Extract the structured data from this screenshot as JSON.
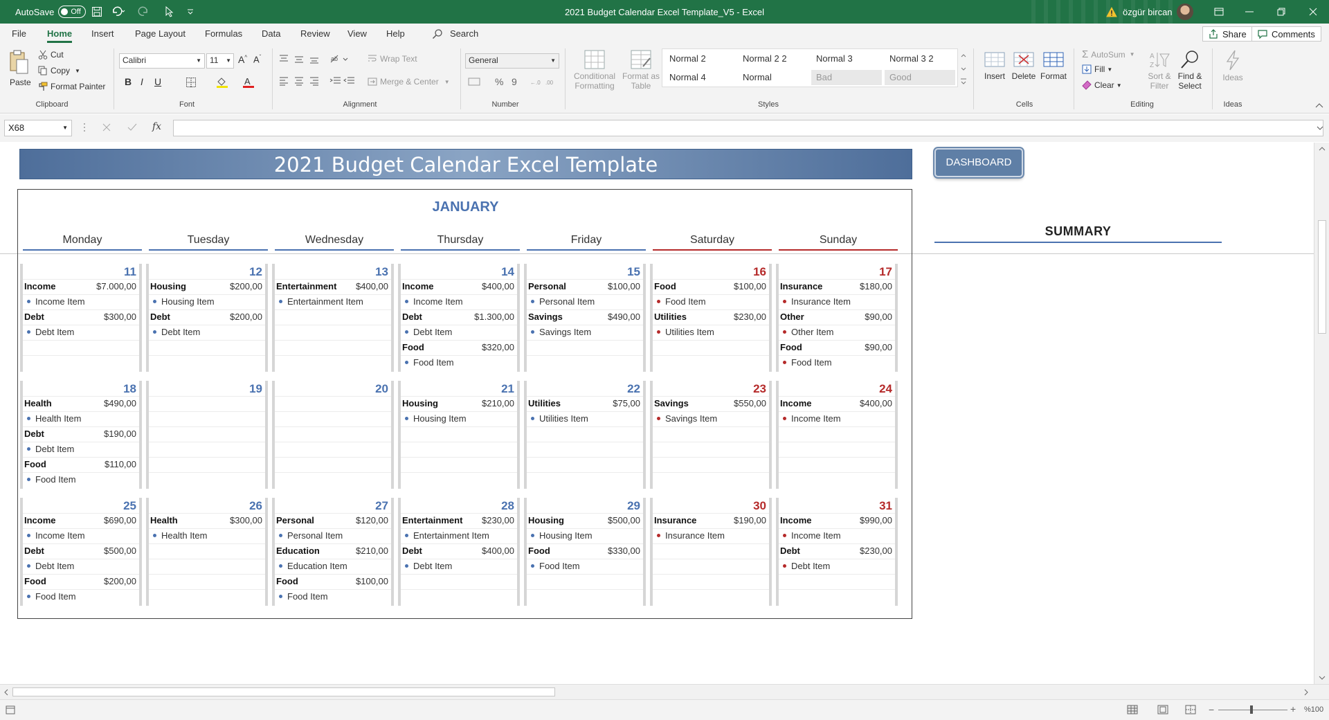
{
  "titlebar": {
    "autosave_label": "AutoSave",
    "autosave_state": "Off",
    "title": "2021 Budget Calendar Excel Template_V5  -  Excel",
    "user": "özgür bircan"
  },
  "menu": {
    "tabs": [
      "File",
      "Home",
      "Insert",
      "Page Layout",
      "Formulas",
      "Data",
      "Review",
      "View",
      "Help"
    ],
    "active": "Home",
    "search": "Search",
    "share": "Share",
    "comments": "Comments"
  },
  "ribbon": {
    "clipboard": {
      "paste": "Paste",
      "cut": "Cut",
      "copy": "Copy",
      "format_painter": "Format Painter",
      "label": "Clipboard"
    },
    "font": {
      "name": "Calibri",
      "size": "11",
      "label": "Font"
    },
    "alignment": {
      "wrap": "Wrap Text",
      "merge": "Merge & Center",
      "label": "Alignment"
    },
    "number": {
      "format": "General",
      "label": "Number"
    },
    "styles": {
      "conditional_1": "Conditional",
      "conditional_2": "Formatting",
      "format_table_1": "Format as",
      "format_table_2": "Table",
      "cells": [
        "Normal 2",
        "Normal 2 2",
        "Normal 3",
        "Normal 3 2",
        "Normal 4",
        "Normal",
        "Bad",
        "Good"
      ],
      "label": "Styles"
    },
    "cells": {
      "insert": "Insert",
      "delete": "Delete",
      "format": "Format",
      "label": "Cells"
    },
    "editing": {
      "autosum": "AutoSum",
      "fill": "Fill",
      "clear": "Clear",
      "sort_1": "Sort &",
      "sort_2": "Filter",
      "find_1": "Find &",
      "find_2": "Select",
      "label": "Editing"
    },
    "ideas": {
      "ideas": "Ideas",
      "label": "Ideas"
    }
  },
  "formula": {
    "namebox": "X68",
    "value": ""
  },
  "sheet": {
    "banner": "2021 Budget Calendar Excel Template",
    "dashboard": "DASHBOARD",
    "month": "JANUARY",
    "summary": "SUMMARY",
    "days": [
      "Monday",
      "Tuesday",
      "Wednesday",
      "Thursday",
      "Friday",
      "Saturday",
      "Sunday"
    ],
    "weeks": [
      [
        {
          "day": "11",
          "entries": [
            {
              "cat": "Income",
              "amt": "$7.000,00",
              "item": "Income Item"
            },
            {
              "cat": "Debt",
              "amt": "$300,00",
              "item": "Debt Item"
            }
          ]
        },
        {
          "day": "12",
          "entries": [
            {
              "cat": "Housing",
              "amt": "$200,00",
              "item": "Housing Item"
            },
            {
              "cat": "Debt",
              "amt": "$200,00",
              "item": "Debt Item"
            }
          ]
        },
        {
          "day": "13",
          "entries": [
            {
              "cat": "Entertainment",
              "amt": "$400,00",
              "item": "Entertainment Item"
            }
          ]
        },
        {
          "day": "14",
          "entries": [
            {
              "cat": "Income",
              "amt": "$400,00",
              "item": "Income Item"
            },
            {
              "cat": "Debt",
              "amt": "$1.300,00",
              "item": "Debt Item"
            },
            {
              "cat": "Food",
              "amt": "$320,00",
              "item": "Food Item"
            }
          ]
        },
        {
          "day": "15",
          "entries": [
            {
              "cat": "Personal",
              "amt": "$100,00",
              "item": "Personal Item"
            },
            {
              "cat": "Savings",
              "amt": "$490,00",
              "item": "Savings Item"
            }
          ]
        },
        {
          "day": "16",
          "entries": [
            {
              "cat": "Food",
              "amt": "$100,00",
              "item": "Food Item"
            },
            {
              "cat": "Utilities",
              "amt": "$230,00",
              "item": "Utilities Item"
            }
          ]
        },
        {
          "day": "17",
          "entries": [
            {
              "cat": "Insurance",
              "amt": "$180,00",
              "item": "Insurance Item"
            },
            {
              "cat": "Other",
              "amt": "$90,00",
              "item": "Other Item"
            },
            {
              "cat": "Food",
              "amt": "$90,00",
              "item": "Food Item"
            }
          ]
        }
      ],
      [
        {
          "day": "18",
          "entries": [
            {
              "cat": "Health",
              "amt": "$490,00",
              "item": "Health Item"
            },
            {
              "cat": "Debt",
              "amt": "$190,00",
              "item": "Debt Item"
            },
            {
              "cat": "Food",
              "amt": "$110,00",
              "item": "Food Item"
            }
          ]
        },
        {
          "day": "19",
          "entries": []
        },
        {
          "day": "20",
          "entries": []
        },
        {
          "day": "21",
          "entries": [
            {
              "cat": "Housing",
              "amt": "$210,00",
              "item": "Housing Item"
            }
          ]
        },
        {
          "day": "22",
          "entries": [
            {
              "cat": "Utilities",
              "amt": "$75,00",
              "item": "Utilities Item"
            }
          ]
        },
        {
          "day": "23",
          "entries": [
            {
              "cat": "Savings",
              "amt": "$550,00",
              "item": "Savings Item"
            }
          ]
        },
        {
          "day": "24",
          "entries": [
            {
              "cat": "Income",
              "amt": "$400,00",
              "item": "Income Item"
            }
          ]
        }
      ],
      [
        {
          "day": "25",
          "entries": [
            {
              "cat": "Income",
              "amt": "$690,00",
              "item": "Income Item"
            },
            {
              "cat": "Debt",
              "amt": "$500,00",
              "item": "Debt Item"
            },
            {
              "cat": "Food",
              "amt": "$200,00",
              "item": "Food Item"
            }
          ]
        },
        {
          "day": "26",
          "entries": [
            {
              "cat": "Health",
              "amt": "$300,00",
              "item": "Health Item"
            }
          ]
        },
        {
          "day": "27",
          "entries": [
            {
              "cat": "Personal",
              "amt": "$120,00",
              "item": "Personal Item"
            },
            {
              "cat": "Education",
              "amt": "$210,00",
              "item": "Education Item"
            },
            {
              "cat": "Food",
              "amt": "$100,00",
              "item": "Food Item"
            }
          ]
        },
        {
          "day": "28",
          "entries": [
            {
              "cat": "Entertainment",
              "amt": "$230,00",
              "item": "Entertainment Item"
            },
            {
              "cat": "Debt",
              "amt": "$400,00",
              "item": "Debt Item"
            }
          ]
        },
        {
          "day": "29",
          "entries": [
            {
              "cat": "Housing",
              "amt": "$500,00",
              "item": "Housing Item"
            },
            {
              "cat": "Food",
              "amt": "$330,00",
              "item": "Food Item"
            }
          ]
        },
        {
          "day": "30",
          "entries": [
            {
              "cat": "Insurance",
              "amt": "$190,00",
              "item": "Insurance Item"
            }
          ]
        },
        {
          "day": "31",
          "entries": [
            {
              "cat": "Income",
              "amt": "$990,00",
              "item": "Income Item"
            },
            {
              "cat": "Debt",
              "amt": "$230,00",
              "item": "Debt Item"
            }
          ]
        }
      ]
    ]
  },
  "status": {
    "zoom": "%100"
  },
  "colors": {
    "excel_green": "#217346",
    "weekday_blue": "#4a72b0",
    "weekend_red": "#b52a2a"
  }
}
